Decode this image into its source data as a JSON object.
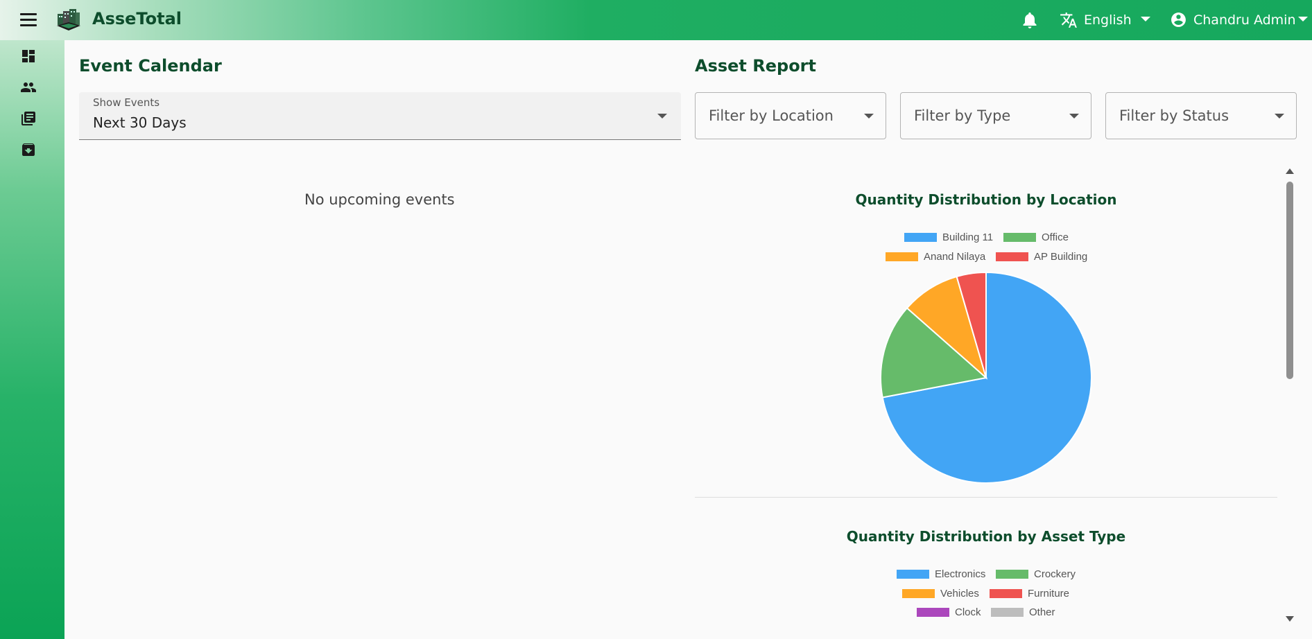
{
  "app": {
    "brand": "AsseTotal"
  },
  "header": {
    "language": "English",
    "user": "Chandru Admin",
    "icons": [
      "menu-icon",
      "bell-icon",
      "translate-icon",
      "account-circle-icon"
    ]
  },
  "sidebar": {
    "items": [
      {
        "icon": "dashboard-icon"
      },
      {
        "icon": "people-icon"
      },
      {
        "icon": "library-books-icon"
      },
      {
        "icon": "archive-icon"
      }
    ]
  },
  "events": {
    "title": "Event Calendar",
    "select_label": "Show Events",
    "select_value": "Next 30 Days",
    "empty_text": "No upcoming events"
  },
  "report": {
    "title": "Asset Report",
    "filters": [
      {
        "placeholder": "Filter by Location"
      },
      {
        "placeholder": "Filter by Type"
      },
      {
        "placeholder": "Filter by Status"
      }
    ]
  },
  "chart_data": [
    {
      "type": "pie",
      "title": "Quantity Distribution by Location",
      "legend_placement": "top",
      "labels": [
        "Building 11",
        "Office",
        "Anand Nilaya",
        "AP Building"
      ],
      "values": [
        72,
        14.5,
        9,
        4.5
      ],
      "colors": [
        "#42a5f5",
        "#66bb6a",
        "#ffa726",
        "#ef5350"
      ]
    },
    {
      "type": "pie",
      "title": "Quantity Distribution by Asset Type",
      "legend_placement": "top",
      "labels": [
        "Electronics",
        "Crockery",
        "Vehicles",
        "Furniture",
        "Clock",
        "Other"
      ],
      "colors": [
        "#42a5f5",
        "#66bb6a",
        "#ffa726",
        "#ef5350",
        "#ab47bc",
        "#bdbdbd"
      ]
    }
  ],
  "colors": {
    "accent": "#16a85d",
    "title": "#0d4d2c"
  }
}
